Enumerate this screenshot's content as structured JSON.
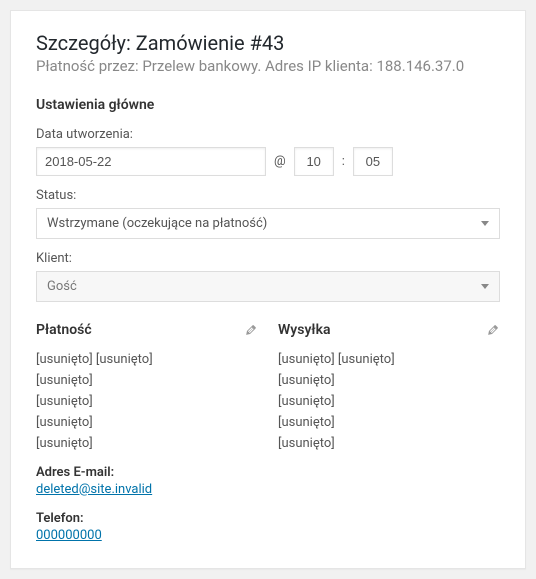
{
  "header": {
    "title": "Szczegóły: Zamówienie #43",
    "subtitle": "Płatność przez: Przelew bankowy. Adres IP klienta: 188.146.37.0"
  },
  "settings": {
    "heading": "Ustawienia główne",
    "created_label": "Data utworzenia:",
    "date": "2018-05-22",
    "at": "@",
    "hour": "10",
    "colon": ":",
    "minute": "05",
    "status_label": "Status:",
    "status_value": "Wstrzymane (oczekujące na płatność)",
    "customer_label": "Klient:",
    "customer_value": "Gość"
  },
  "billing": {
    "heading": "Płatność",
    "lines": [
      "[usunięto] [usunięto]",
      "[usunięto]",
      "[usunięto]",
      "[usunięto]",
      "[usunięto]"
    ],
    "email_label": "Adres E-mail:",
    "email_value": "deleted@site.invalid",
    "phone_label": "Telefon:",
    "phone_value": "000000000"
  },
  "shipping": {
    "heading": "Wysyłka",
    "lines": [
      "[usunięto] [usunięto]",
      "[usunięto]",
      "[usunięto]",
      "[usunięto]",
      "[usunięto]"
    ]
  }
}
